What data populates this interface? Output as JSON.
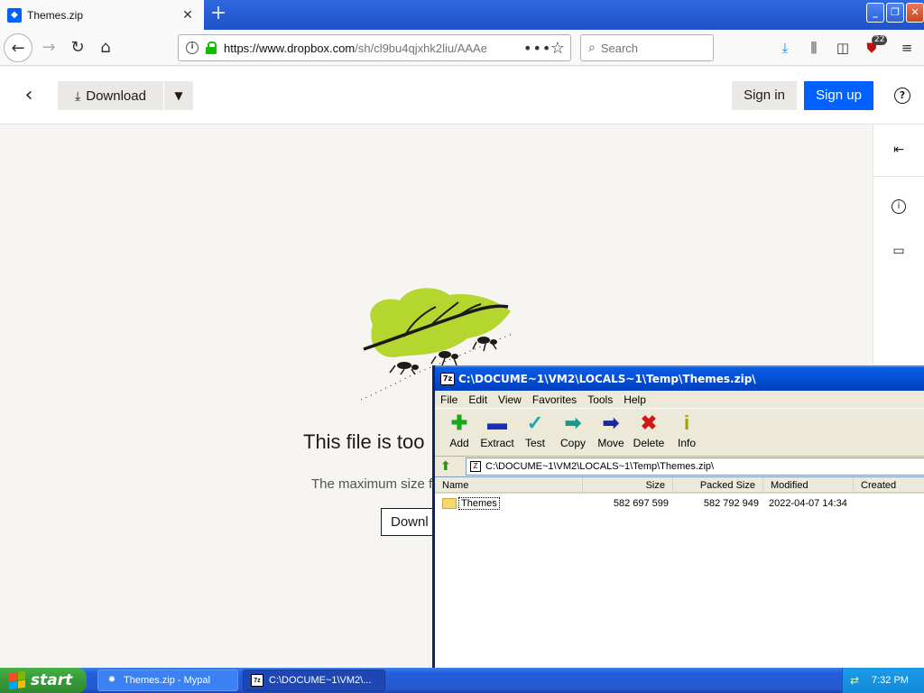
{
  "browser": {
    "tab_title": "Themes.zip",
    "new_tab": "+",
    "url_host": "https://www.dropbox.com",
    "url_path": "/sh/cl9bu4qjxhk2liu/AAAe",
    "search_placeholder": "Search",
    "badge_count": "22"
  },
  "dropbox": {
    "download_label": "Download",
    "signin_label": "Sign in",
    "signup_label": "Sign up",
    "message_title": "This file is too",
    "message_sub": "The maximum size f",
    "download2_label": "Downl"
  },
  "sevenzip": {
    "title": "C:\\DOCUME~1\\VM2\\LOCALS~1\\Temp\\Themes.zip\\",
    "menu": [
      "File",
      "Edit",
      "View",
      "Favorites",
      "Tools",
      "Help"
    ],
    "tools": [
      {
        "label": "Add",
        "icon": "add-icon",
        "color": "#1aa81a"
      },
      {
        "label": "Extract",
        "icon": "extract-icon",
        "color": "#1a2fb8"
      },
      {
        "label": "Test",
        "icon": "test-icon",
        "color": "#18a8b8"
      },
      {
        "label": "Copy",
        "icon": "copy-icon",
        "color": "#1a9a8a"
      },
      {
        "label": "Move",
        "icon": "move-icon",
        "color": "#1a2a9a"
      },
      {
        "label": "Delete",
        "icon": "delete-icon",
        "color": "#d01818"
      },
      {
        "label": "Info",
        "icon": "info-icon",
        "color": "#a0a000"
      }
    ],
    "address": "C:\\DOCUME~1\\VM2\\LOCALS~1\\Temp\\Themes.zip\\",
    "columns": [
      "Name",
      "Size",
      "Packed Size",
      "Modified",
      "Created"
    ],
    "rows": [
      {
        "name": "Themes",
        "size": "582 697 599",
        "packed": "582 792 949",
        "modified": "2022-04-07 14:34",
        "created": ""
      }
    ]
  },
  "taskbar": {
    "start_label": "start",
    "tasks": [
      {
        "label": "Themes.zip - Mypal"
      },
      {
        "label": "C:\\DOCUME~1\\VM2\\..."
      }
    ],
    "clock": "7:32 PM"
  }
}
